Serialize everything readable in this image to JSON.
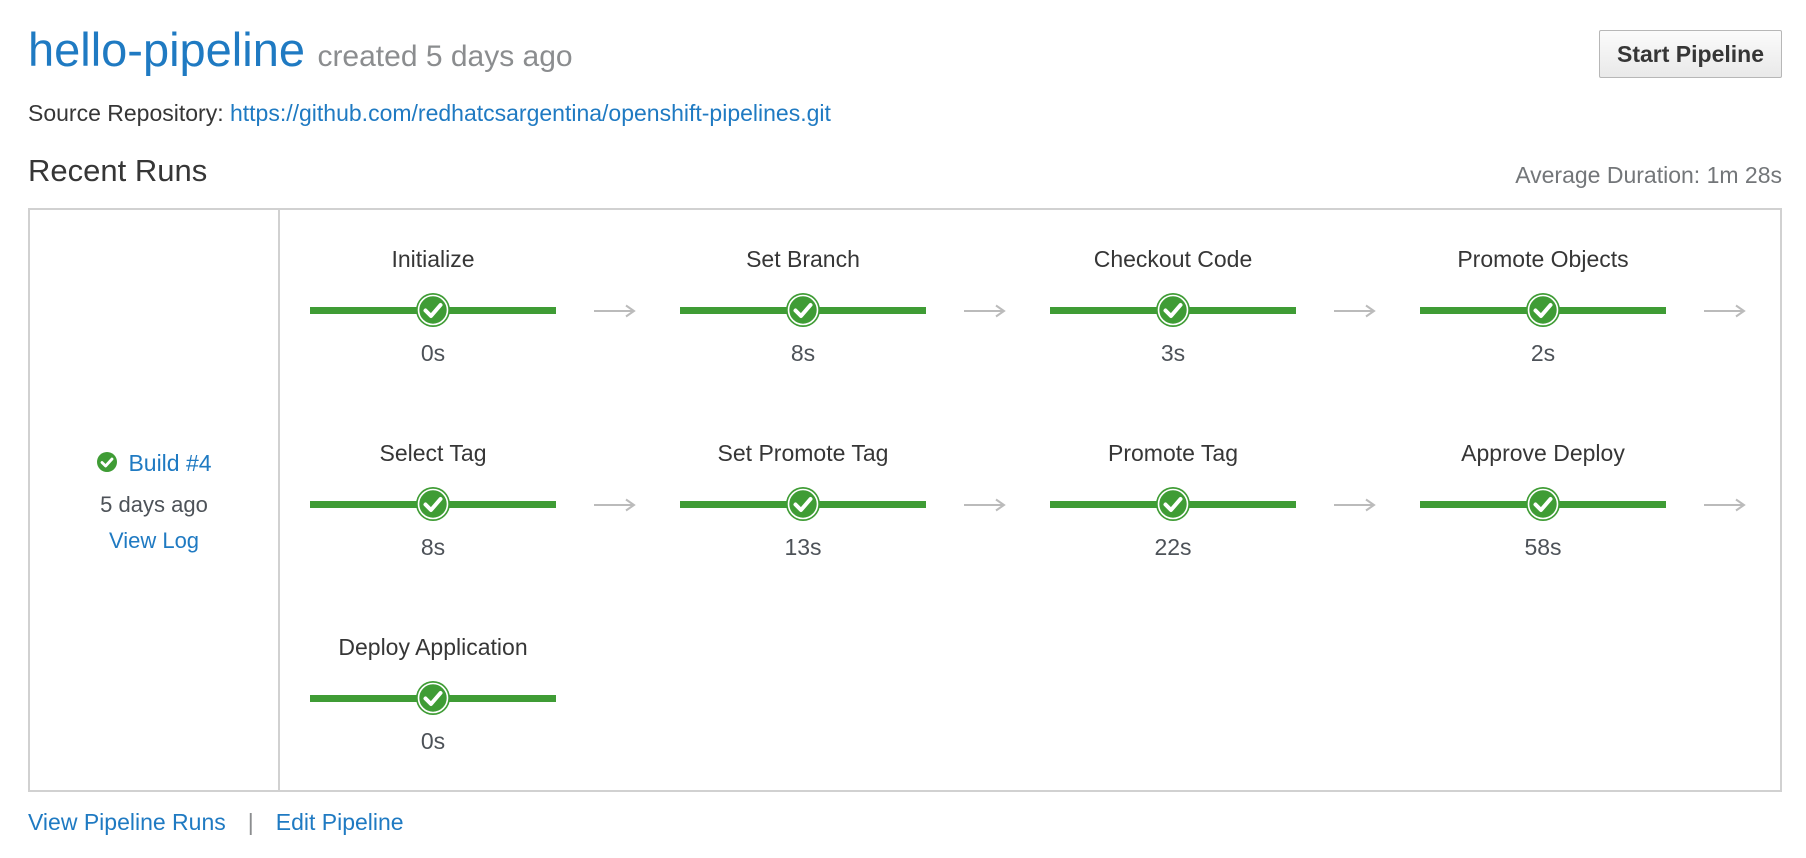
{
  "pipeline": {
    "name": "hello-pipeline",
    "created": "created 5 days ago",
    "start_button": "Start Pipeline",
    "source_label": "Source Repository:",
    "source_url": "https://github.com/redhatcsargentina/openshift-pipelines.git"
  },
  "recent_runs": {
    "title": "Recent Runs",
    "average_duration": "Average Duration: 1m 28s"
  },
  "run": {
    "status": "complete",
    "build_label": "Build #4",
    "age": "5 days ago",
    "view_log": "View Log"
  },
  "stages": [
    {
      "name": "Initialize",
      "duration": "0s",
      "status": "complete"
    },
    {
      "name": "Set Branch",
      "duration": "8s",
      "status": "complete"
    },
    {
      "name": "Checkout Code",
      "duration": "3s",
      "status": "complete"
    },
    {
      "name": "Promote Objects",
      "duration": "2s",
      "status": "complete"
    },
    {
      "name": "Select Tag",
      "duration": "8s",
      "status": "complete"
    },
    {
      "name": "Set Promote Tag",
      "duration": "13s",
      "status": "complete"
    },
    {
      "name": "Promote Tag",
      "duration": "22s",
      "status": "complete"
    },
    {
      "name": "Approve Deploy",
      "duration": "58s",
      "status": "complete"
    },
    {
      "name": "Deploy Application",
      "duration": "0s",
      "status": "complete"
    }
  ],
  "footer": {
    "view_runs": "View Pipeline Runs",
    "separator": "|",
    "edit_pipeline": "Edit Pipeline"
  },
  "colors": {
    "success": "#3f9c35",
    "link": "#1f7ac2",
    "arrow": "#bbbbbb"
  }
}
